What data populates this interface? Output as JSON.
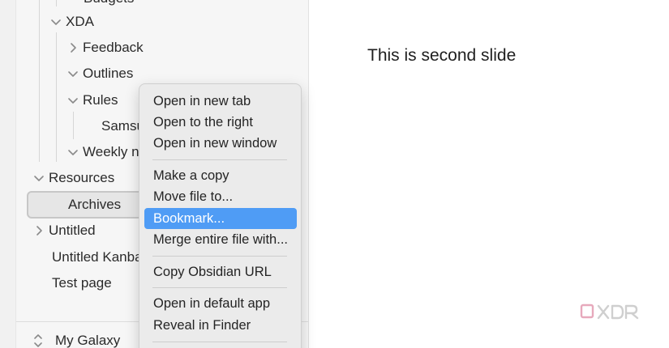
{
  "sidebar": {
    "items": [
      {
        "id": "budgets",
        "label": "Budgets"
      },
      {
        "id": "xda",
        "label": "XDA"
      },
      {
        "id": "feedback",
        "label": "Feedback"
      },
      {
        "id": "outlines",
        "label": "Outlines"
      },
      {
        "id": "rules",
        "label": "Rules"
      },
      {
        "id": "samsung",
        "label": "Samsu"
      },
      {
        "id": "weekly",
        "label": "Weekly n"
      },
      {
        "id": "resources",
        "label": "Resources"
      },
      {
        "id": "archives",
        "label": "Archives"
      },
      {
        "id": "untitled",
        "label": "Untitled"
      },
      {
        "id": "untitled-kanban",
        "label": "Untitled Kanba"
      },
      {
        "id": "test-page",
        "label": "Test page"
      }
    ],
    "vault_name": "My Galaxy"
  },
  "editor": {
    "content": "This is second slide"
  },
  "context_menu": {
    "items": [
      "Open in new tab",
      "Open to the right",
      "Open in new window",
      "Make a copy",
      "Move file to...",
      "Bookmark...",
      "Merge entire file with...",
      "Copy Obsidian URL",
      "Open in default app",
      "Reveal in Finder"
    ],
    "highlighted": "Bookmark..."
  },
  "colors": {
    "highlight": "#4f9cf5",
    "sidebar_bg": "#f6f6f6",
    "menu_bg": "#ebebeb"
  }
}
